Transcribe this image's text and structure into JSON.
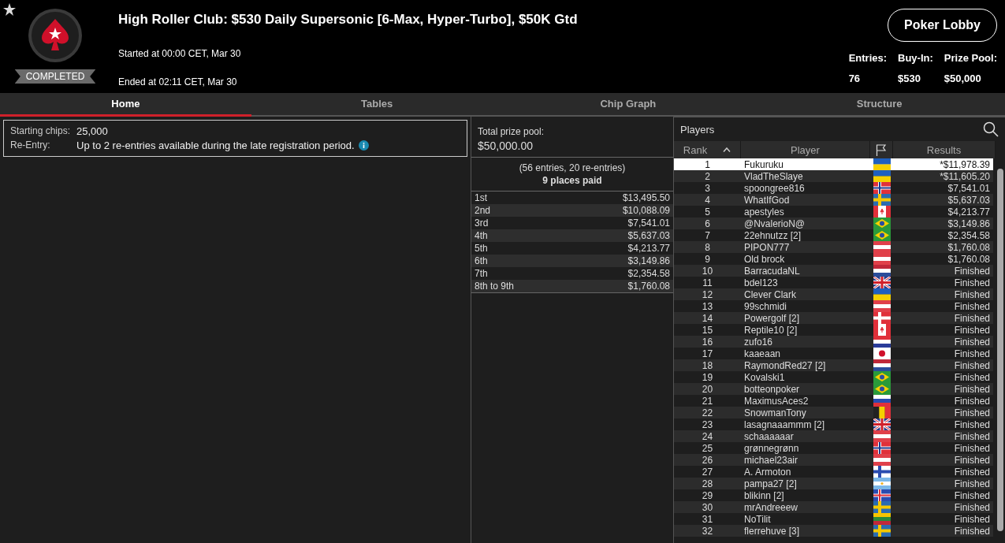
{
  "header": {
    "title": "High Roller Club: $530 Daily Supersonic [6-Max, Hyper-Turbo], $50K Gtd",
    "status": "COMPLETED",
    "started": "Started at 00:00 CET, Mar 30",
    "ended": "Ended at 02:11 CET, Mar 30",
    "lobby_button": "Poker Lobby",
    "stats": [
      {
        "label": "Entries:",
        "value": "76"
      },
      {
        "label": "Buy-In:",
        "value": "$530"
      },
      {
        "label": "Prize Pool:",
        "value": "$50,000"
      }
    ]
  },
  "tabs": [
    {
      "label": "Home",
      "selected": true
    },
    {
      "label": "Tables",
      "selected": false
    },
    {
      "label": "Chip Graph",
      "selected": false
    },
    {
      "label": "Structure",
      "selected": false
    }
  ],
  "info": [
    {
      "label": "Starting chips:",
      "value": "25,000",
      "info_icon": false
    },
    {
      "label": "Re-Entry:",
      "value": "Up to 2 re-entries available during the late registration period.",
      "info_icon": true
    }
  ],
  "prize_pool": {
    "label": "Total prize pool:",
    "amount": "$50,000.00",
    "entries_note": "(56 entries, 20 re-entries)",
    "places_paid": "9 places paid",
    "payouts": [
      {
        "place": "1st",
        "amount": "$13,495.50"
      },
      {
        "place": "2nd",
        "amount": "$10,088.09"
      },
      {
        "place": "3rd",
        "amount": "$7,541.01"
      },
      {
        "place": "4th",
        "amount": "$5,637.03"
      },
      {
        "place": "5th",
        "amount": "$4,213.77"
      },
      {
        "place": "6th",
        "amount": "$3,149.86"
      },
      {
        "place": "7th",
        "amount": "$2,354.58"
      },
      {
        "place": "8th to 9th",
        "amount": "$1,760.08"
      }
    ]
  },
  "players": {
    "title": "Players",
    "columns": [
      "Rank",
      "Player",
      "Results"
    ],
    "rows": [
      {
        "rank": "1",
        "player": "Fukuruku",
        "flag": {
          "kind": "ua"
        },
        "result": "*$11,978.39",
        "selected": true
      },
      {
        "rank": "2",
        "player": "VladTheSlaye",
        "flag": {
          "kind": "ua"
        },
        "result": "*$11,605.20",
        "selected": false
      },
      {
        "rank": "3",
        "player": "spoongree816",
        "flag": {
          "kind": "no"
        },
        "result": "$7,541.01",
        "selected": false
      },
      {
        "rank": "4",
        "player": "WhatIfGod",
        "flag": {
          "kind": "se"
        },
        "result": "$5,637.03",
        "selected": false
      },
      {
        "rank": "5",
        "player": "apestyles",
        "flag": {
          "kind": "ca"
        },
        "result": "$4,213.77",
        "selected": false
      },
      {
        "rank": "6",
        "player": "@NvalerioN@",
        "flag": {
          "kind": "br"
        },
        "result": "$3,149.86",
        "selected": false
      },
      {
        "rank": "7",
        "player": "22ehnutzz [2]",
        "flag": {
          "kind": "br"
        },
        "result": "$2,354.58",
        "selected": false
      },
      {
        "rank": "8",
        "player": "PIPON777",
        "flag": {
          "kind": "at"
        },
        "result": "$1,760.08",
        "selected": false
      },
      {
        "rank": "9",
        "player": "Old brock",
        "flag": {
          "kind": "at"
        },
        "result": "$1,760.08",
        "selected": false
      },
      {
        "rank": "10",
        "player": "BarracudaNL",
        "flag": {
          "kind": "nl"
        },
        "result": "Finished",
        "selected": false
      },
      {
        "rank": "11",
        "player": "bdel123",
        "flag": {
          "kind": "gb"
        },
        "result": "Finished",
        "selected": false
      },
      {
        "rank": "12",
        "player": "Clever Clark",
        "flag": {
          "kind": "ua"
        },
        "result": "Finished",
        "selected": false
      },
      {
        "rank": "13",
        "player": "99schmidi",
        "flag": {
          "kind": "at"
        },
        "result": "Finished",
        "selected": false
      },
      {
        "rank": "14",
        "player": "Powergolf [2]",
        "flag": {
          "kind": "dk"
        },
        "result": "Finished",
        "selected": false
      },
      {
        "rank": "15",
        "player": "Reptile10 [2]",
        "flag": {
          "kind": "ca"
        },
        "result": "Finished",
        "selected": false
      },
      {
        "rank": "16",
        "player": "zufo16",
        "flag": {
          "kind": "hr"
        },
        "result": "Finished",
        "selected": false
      },
      {
        "rank": "17",
        "player": "kaaeaan",
        "flag": {
          "kind": "jp"
        },
        "result": "Finished",
        "selected": false
      },
      {
        "rank": "18",
        "player": "RaymondRed27 [2]",
        "flag": {
          "kind": "nl"
        },
        "result": "Finished",
        "selected": false
      },
      {
        "rank": "19",
        "player": "Kovalski1",
        "flag": {
          "kind": "br"
        },
        "result": "Finished",
        "selected": false
      },
      {
        "rank": "20",
        "player": "botteonpoker",
        "flag": {
          "kind": "br"
        },
        "result": "Finished",
        "selected": false
      },
      {
        "rank": "21",
        "player": "MaximusAces2",
        "flag": {
          "kind": "ru"
        },
        "result": "Finished",
        "selected": false
      },
      {
        "rank": "22",
        "player": "SnowmanTony",
        "flag": {
          "kind": "be"
        },
        "result": "Finished",
        "selected": false
      },
      {
        "rank": "23",
        "player": "lasagnaaammm [2]",
        "flag": {
          "kind": "gb"
        },
        "result": "Finished",
        "selected": false
      },
      {
        "rank": "24",
        "player": "schaaaaaar",
        "flag": {
          "kind": "at"
        },
        "result": "Finished",
        "selected": false
      },
      {
        "rank": "25",
        "player": "grønnegrønn",
        "flag": {
          "kind": "no"
        },
        "result": "Finished",
        "selected": false
      },
      {
        "rank": "26",
        "player": "michael23air",
        "flag": {
          "kind": "at"
        },
        "result": "Finished",
        "selected": false
      },
      {
        "rank": "27",
        "player": "A. Armoton",
        "flag": {
          "kind": "fi"
        },
        "result": "Finished",
        "selected": false
      },
      {
        "rank": "28",
        "player": "pampa27 [2]",
        "flag": {
          "kind": "ar"
        },
        "result": "Finished",
        "selected": false
      },
      {
        "rank": "29",
        "player": "blikinn [2]",
        "flag": {
          "kind": "is"
        },
        "result": "Finished",
        "selected": false
      },
      {
        "rank": "30",
        "player": "mrAndreeew",
        "flag": {
          "kind": "se"
        },
        "result": "Finished",
        "selected": false
      },
      {
        "rank": "31",
        "player": "NoTilit",
        "flag": {
          "kind": "lt"
        },
        "result": "Finished",
        "selected": false
      },
      {
        "rank": "32",
        "player": "flerrehuve [3]",
        "flag": {
          "kind": "se"
        },
        "result": "Finished",
        "selected": false
      }
    ]
  }
}
